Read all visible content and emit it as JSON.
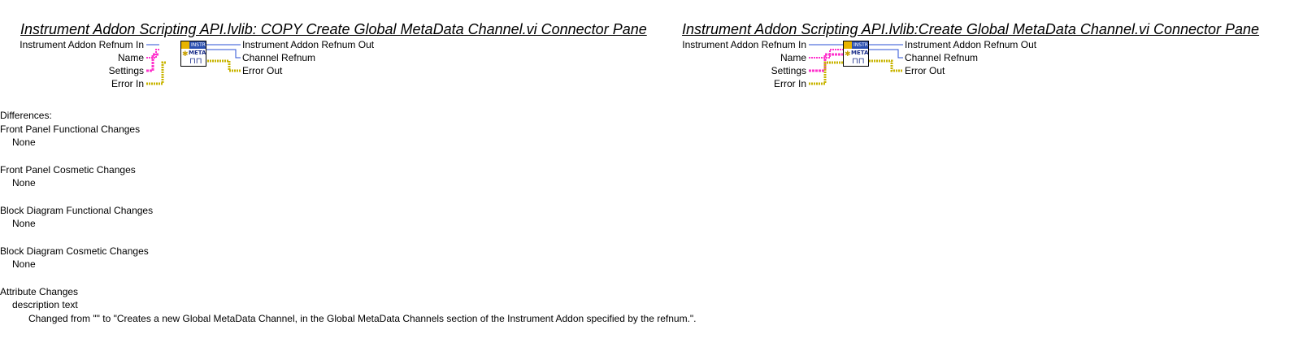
{
  "left_pane": {
    "title": "Instrument Addon Scripting API.lvlib:  COPY  Create Global MetaData Channel.vi Connector Pane",
    "inputs": [
      "Instrument Addon Refnum In",
      "Name",
      "Settings",
      "Error In"
    ],
    "outputs": [
      "Instrument Addon Refnum Out",
      "Channel Refnum",
      "Error Out"
    ],
    "icon_text_top": "INSTR",
    "icon_text_main": "META"
  },
  "right_pane": {
    "title": "Instrument Addon Scripting API.lvlib:Create Global MetaData Channel.vi Connector Pane",
    "inputs": [
      "Instrument Addon Refnum In",
      "Name",
      "Settings",
      "Error In"
    ],
    "outputs": [
      "Instrument Addon Refnum Out",
      "Channel Refnum",
      "Error Out"
    ],
    "icon_text_top": "INSTR",
    "icon_text_main": "META"
  },
  "wire_colors": {
    "refnum": "#2a4fd6",
    "string": "#ff33cc",
    "cluster": "#8a7a00",
    "error": "#c8b400"
  },
  "report": {
    "heading": "Differences:",
    "sections": [
      {
        "title": "Front Panel Functional Changes",
        "detail": "None"
      },
      {
        "title": "Front Panel Cosmetic Changes",
        "detail": "None"
      },
      {
        "title": "Block Diagram Functional Changes",
        "detail": "None"
      },
      {
        "title": "Block Diagram Cosmetic Changes",
        "detail": "None"
      }
    ],
    "attribute_title": "Attribute Changes",
    "attribute_item": "description text",
    "attribute_change": "Changed from \"\" to \"Creates a new Global MetaData Channel, in the Global MetaData Channels section of the Instrument Addon specified by the refnum.\"."
  }
}
